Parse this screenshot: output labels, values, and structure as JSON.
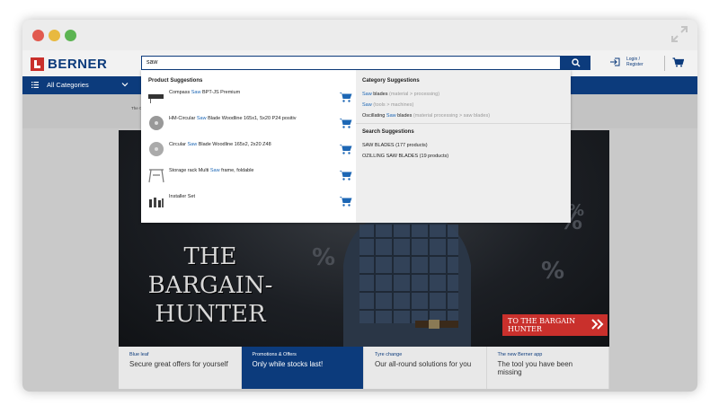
{
  "header": {
    "logo_text": "BERNER",
    "search_value": "saw",
    "login_line1": "Login /",
    "login_line2": "Register"
  },
  "nav": {
    "all_categories": "All Categories"
  },
  "breadcrumb": "The C",
  "dropdown": {
    "product_heading": "Product Suggestions",
    "products": [
      {
        "pre": "Compass ",
        "hl": "Saw",
        "post": " BPT-JS Premium"
      },
      {
        "pre": "HM-Circular ",
        "hl": "Saw",
        "post": " Blade Woodline 165x1, 5x20 P24 positiv"
      },
      {
        "pre": "Circular ",
        "hl": "Saw",
        "post": " Blade Woodline 165x2, 2x20 Z48"
      },
      {
        "pre": "Storage rack Multi ",
        "hl": "Saw",
        "post": " frame, foldable"
      },
      {
        "pre": "Installer Set",
        "hl": "",
        "post": ""
      }
    ],
    "category_heading": "Category Suggestions",
    "categories": [
      {
        "hl": "Saw",
        "main": " blades",
        "path": " (material > processing)"
      },
      {
        "hl": "Saw",
        "main": "",
        "path": " (tools > machines)"
      },
      {
        "pre": "Oscillating ",
        "hl": "Saw",
        "main": " blades",
        "path": " (material processing > saw blades)"
      }
    ],
    "search_heading": "Search Suggestions",
    "searches": [
      "SAW BLADES (177 products)",
      "OZILLING SAW BLADES (19 products)"
    ]
  },
  "hero": {
    "title_line1": "THE",
    "title_line2": "BARGAIN-",
    "title_line3": "HUNTER",
    "cta": "TO THE BARGAIN HUNTER"
  },
  "tiles": [
    {
      "kicker": "Blue leaf",
      "text": "Secure great offers for yourself"
    },
    {
      "kicker": "Promotions & Offers",
      "text": "Only while stocks last!"
    },
    {
      "kicker": "Tyre change",
      "text": "Our all-round solutions for you"
    },
    {
      "kicker": "The new Berner app",
      "text": "The tool you have been missing"
    }
  ],
  "colors": {
    "brand_blue": "#0c3b7c",
    "brand_red": "#c9302c",
    "highlight_blue": "#1d67b5"
  }
}
